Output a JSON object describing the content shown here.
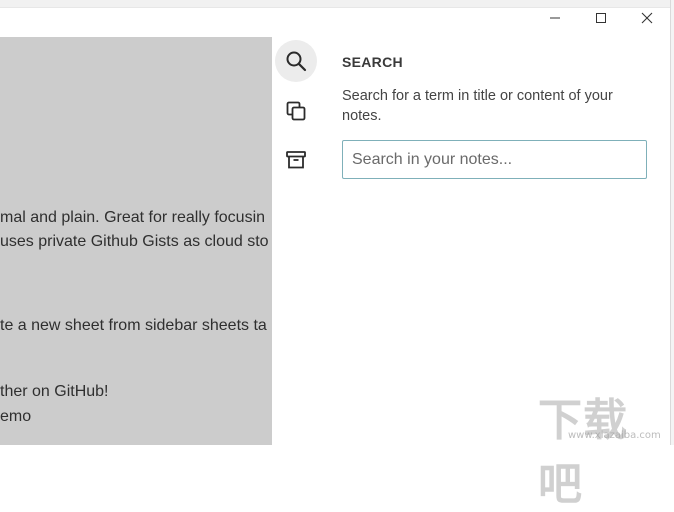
{
  "window": {
    "controls": {
      "minimize_icon": "minimize-icon",
      "maximize_icon": "maximize-icon",
      "close_icon": "close-icon"
    }
  },
  "editor": {
    "lines": [
      "mal and plain. Great for really focusin",
      "uses private Github Gists as cloud sto",
      "te a new sheet from sidebar sheets ta",
      "ther on GitHub!",
      "emo"
    ]
  },
  "sidebar": {
    "items": [
      {
        "icon": "search-icon",
        "active": true
      },
      {
        "icon": "copy-icon",
        "active": false
      },
      {
        "icon": "archive-icon",
        "active": false
      }
    ]
  },
  "search": {
    "heading": "SEARCH",
    "description": "Search for a term in title or content of your notes.",
    "placeholder": "Search in your notes...",
    "value": ""
  },
  "watermark": {
    "text": "下载吧",
    "url": "www.xiazaiba.com"
  },
  "colors": {
    "editor_bg": "#cccccc",
    "panel_bg": "#ffffff",
    "input_border": "#7fb0b9",
    "active_rail_bg": "#ececec"
  }
}
